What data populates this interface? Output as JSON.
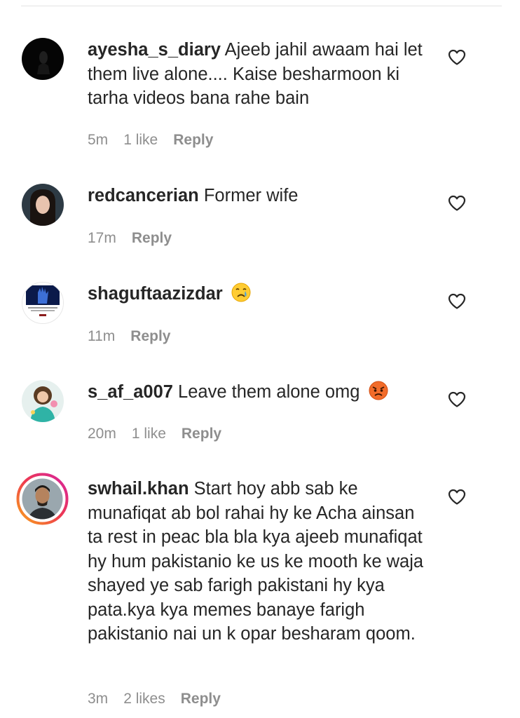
{
  "comments": [
    {
      "username": "ayesha_s_diary",
      "text": "Ajeeb jahil awaam hai let them live alone.... Kaise besharmoon ki tarha videos bana rahe bain",
      "time": "5m",
      "likes": "1 like",
      "reply": "Reply",
      "emoji": ""
    },
    {
      "username": "redcancerian",
      "text": "Former wife",
      "time": "17m",
      "likes": "",
      "reply": "Reply",
      "emoji": ""
    },
    {
      "username": "shaguftaazizdar",
      "text": "",
      "time": "11m",
      "likes": "",
      "reply": "Reply",
      "emoji": "crying-face"
    },
    {
      "username": "s_af_a007",
      "text": "Leave them alone omg",
      "time": "20m",
      "likes": "1 like",
      "reply": "Reply",
      "emoji": "angry-face"
    },
    {
      "username": "swhail.khan",
      "text": "Start hoy abb sab ke munafiqat ab bol rahai hy ke Acha ainsan ta rest in peac bla bla kya ajeeb munafiqat hy hum pakistanio ke us ke mooth ke waja shayed ye sab farigh pakistani hy kya pata.kya kya memes banaye farigh pakistanio nai un k opar besharam qoom.",
      "time": "3m",
      "likes": "2 likes",
      "reply": "Reply",
      "emoji": ""
    }
  ],
  "icons": {
    "like": "heart-outline-icon"
  },
  "colors": {
    "text": "#262626",
    "meta": "#8e8e8e",
    "story_ring_start": "#f9a51a",
    "story_ring_end": "#d6249f"
  }
}
